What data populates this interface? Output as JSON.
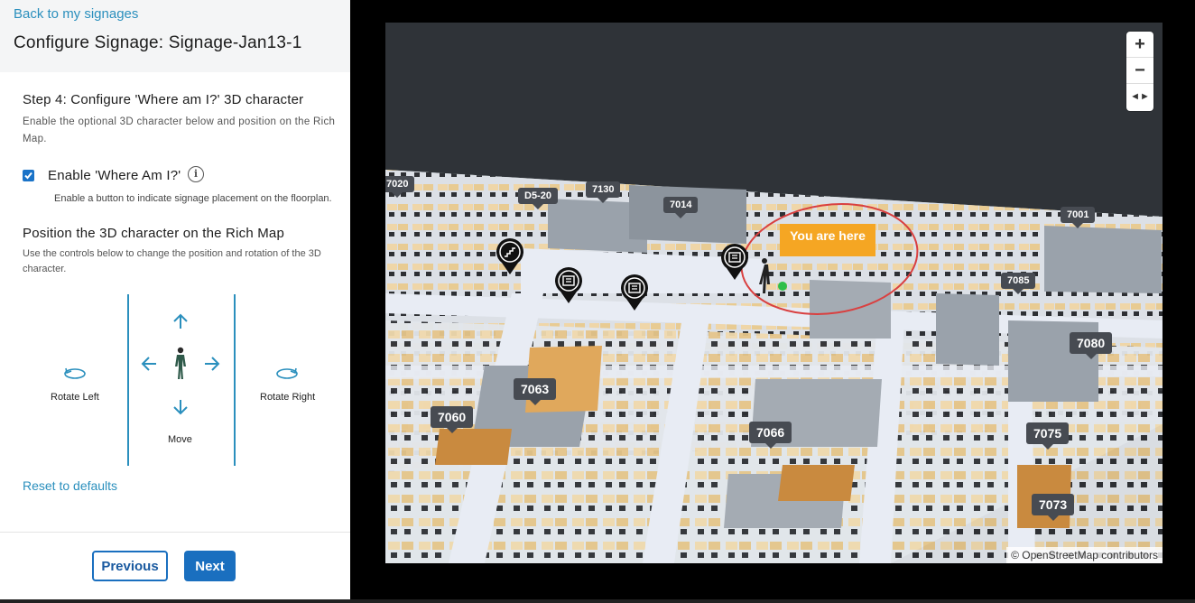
{
  "header": {
    "back_link": "Back to my signages",
    "title": "Configure Signage: Signage-Jan13-1"
  },
  "step": {
    "title": "Step 4: Configure 'Where am I?' 3D character",
    "description": "Enable the optional 3D character below and position on the Rich Map."
  },
  "enable_option": {
    "label": "Enable 'Where Am I?'",
    "checked": true,
    "help": "Enable a button to indicate signage placement on the floorplan.",
    "info_icon": "info-icon"
  },
  "position": {
    "title": "Position the 3D character on the Rich Map",
    "description": "Use the controls below to change the position and rotation of the 3D character."
  },
  "controls": {
    "rotate_left": "Rotate Left",
    "rotate_right": "Rotate Right",
    "move": "Move"
  },
  "reset_link": "Reset to defaults",
  "footer": {
    "previous": "Previous",
    "next": "Next"
  },
  "map": {
    "zoom_in": "+",
    "zoom_out": "−",
    "compass": "◄►",
    "attribution": "© OpenStreetMap contributors",
    "you_are_here": "You are here",
    "rooms": [
      "7020",
      "D5-20",
      "7130",
      "7014",
      "7001",
      "7085",
      "7080",
      "7063",
      "7060",
      "7066",
      "7075",
      "7073"
    ],
    "pins": [
      "stairs-pin-icon",
      "info-board-pin-icon",
      "info-board-pin-icon",
      "info-board-pin-icon"
    ]
  },
  "colors": {
    "accent": "#1a6fbf",
    "link": "#2a8fbd",
    "here_label": "#f5a623",
    "highlight_circle": "#d94040",
    "map_bg": "#2f3338"
  }
}
